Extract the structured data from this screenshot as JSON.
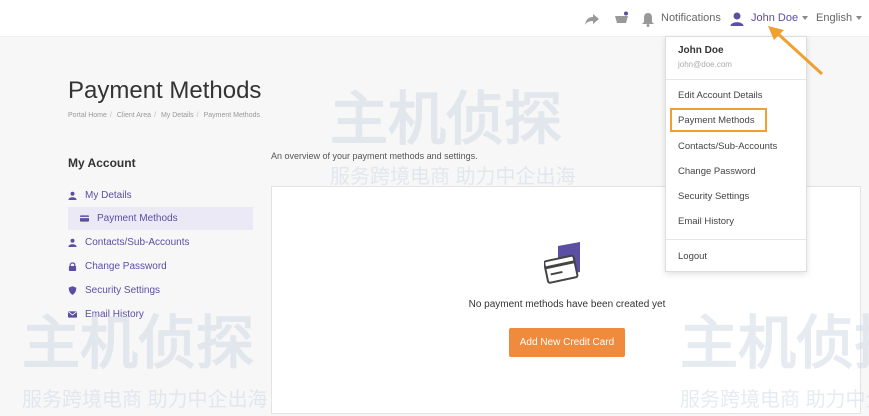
{
  "topbar": {
    "notifications_label": "Notifications",
    "user_label": "John Doe",
    "language_label": "English"
  },
  "page": {
    "title": "Payment Methods",
    "breadcrumb": [
      "Portal Home",
      "Client Area",
      "My Details",
      "Payment Methods"
    ]
  },
  "sidebar": {
    "heading": "My Account",
    "items": [
      {
        "label": "My Details",
        "icon": "user-icon"
      },
      {
        "label": "Payment Methods",
        "icon": "credit-card-icon"
      },
      {
        "label": "Contacts/Sub-Accounts",
        "icon": "user-icon"
      },
      {
        "label": "Change Password",
        "icon": "lock-icon"
      },
      {
        "label": "Security Settings",
        "icon": "shield-icon"
      },
      {
        "label": "Email History",
        "icon": "envelope-icon"
      }
    ]
  },
  "content": {
    "overview": "An overview of your payment methods and settings.",
    "empty_message": "No payment methods have been created yet",
    "add_button": "Add New Credit Card"
  },
  "dropdown": {
    "name": "John Doe",
    "email": "john@doe.com",
    "items": [
      "Edit Account Details",
      "Payment Methods",
      "Contacts/Sub-Accounts",
      "Change Password",
      "Security Settings",
      "Email History"
    ],
    "logout": "Logout"
  },
  "watermark": {
    "brand": "主机侦探",
    "tagline": "服务跨境电商 助力中企出海"
  },
  "colors": {
    "accent": "#5b4fa3",
    "button": "#f08a3c",
    "highlight": "#f0a030"
  }
}
